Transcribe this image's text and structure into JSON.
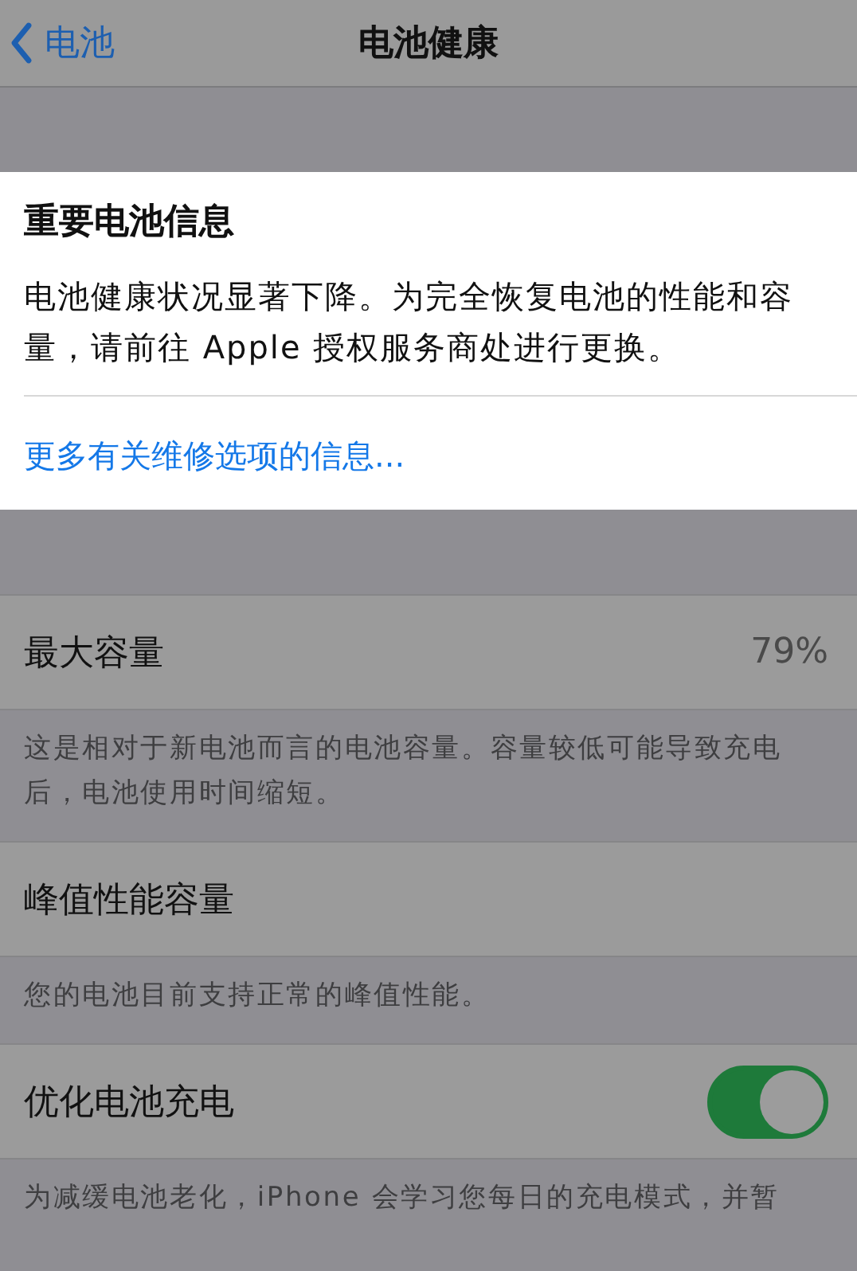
{
  "nav": {
    "back_label": "电池",
    "title": "电池健康"
  },
  "alert": {
    "title": "重要电池信息",
    "body": "电池健康状况显著下降。为完全恢复电池的性能和容量，请前往 Apple 授权服务商处进行更换。",
    "link": "更多有关维修选项的信息..."
  },
  "rows": [
    {
      "kind": "value",
      "label": "最大容量",
      "value": "79%",
      "footer": "这是相对于新电池而言的电池容量。容量较低可能导致充电后，电池使用时间缩短。"
    },
    {
      "kind": "plain",
      "label": "峰值性能容量",
      "footer": "您的电池目前支持正常的峰值性能。"
    },
    {
      "kind": "toggle",
      "label": "优化电池充电",
      "on": true,
      "footer": "为减缓电池老化，iPhone 会学习您每日的充电模式，并暂"
    }
  ]
}
